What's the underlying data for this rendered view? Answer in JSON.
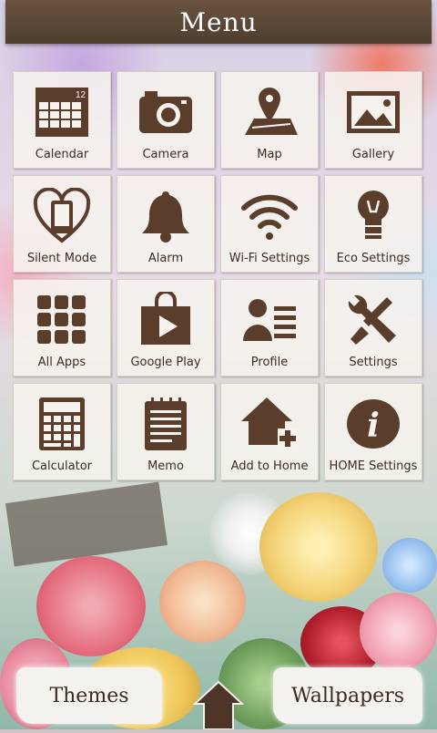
{
  "header": {
    "title": "Menu"
  },
  "tiles": [
    {
      "label": "Calendar",
      "icon": "calendar-icon",
      "badge": "12"
    },
    {
      "label": "Camera",
      "icon": "camera-icon"
    },
    {
      "label": "Map",
      "icon": "map-pin-icon"
    },
    {
      "label": "Gallery",
      "icon": "gallery-icon"
    },
    {
      "label": "Silent Mode",
      "icon": "phone-heart-icon"
    },
    {
      "label": "Alarm",
      "icon": "bell-icon"
    },
    {
      "label": "Wi-Fi Settings",
      "icon": "wifi-icon"
    },
    {
      "label": "Eco Settings",
      "icon": "lightbulb-icon"
    },
    {
      "label": "All Apps",
      "icon": "apps-grid-icon"
    },
    {
      "label": "Google Play",
      "icon": "play-bag-icon"
    },
    {
      "label": "Profile",
      "icon": "profile-card-icon"
    },
    {
      "label": "Settings",
      "icon": "tools-icon"
    },
    {
      "label": "Calculator",
      "icon": "calculator-icon"
    },
    {
      "label": "Memo",
      "icon": "memo-icon"
    },
    {
      "label": "Add to Home",
      "icon": "house-plus-icon"
    },
    {
      "label": "HOME Settings",
      "icon": "info-icon"
    }
  ],
  "bottom": {
    "themes_label": "Themes",
    "wallpapers_label": "Wallpapers",
    "home_icon": "home-arrow-icon"
  },
  "colors": {
    "icon_brown": "#5a3e2b",
    "header_brown": "#5a4634",
    "tile_bg": "#f6f3ee"
  }
}
